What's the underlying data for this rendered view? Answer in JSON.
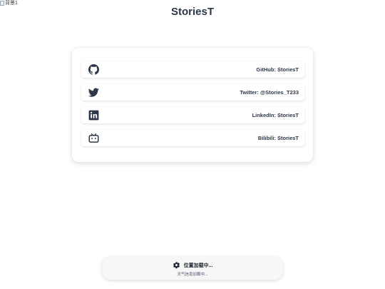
{
  "background_image": {
    "alt_text": "背景1"
  },
  "header": {
    "title": "StoriesT"
  },
  "social_links": [
    {
      "icon": "github-icon",
      "label": "GitHub: StoriesT"
    },
    {
      "icon": "twitter-icon",
      "label": "Twitter: @Stories_T233"
    },
    {
      "icon": "linkedin-icon",
      "label": "LinkedIn: StoriesT"
    },
    {
      "icon": "bilibili-icon",
      "label": "Bilibili: StoriesT"
    }
  ],
  "status": {
    "icon": "gear-icon",
    "location_text": "位置加载中...",
    "weather_text": "天气信息加载中..."
  },
  "colors": {
    "text": "#2d3748",
    "card_bg": "#ffffff",
    "status_bg": "#f7f7f7"
  }
}
